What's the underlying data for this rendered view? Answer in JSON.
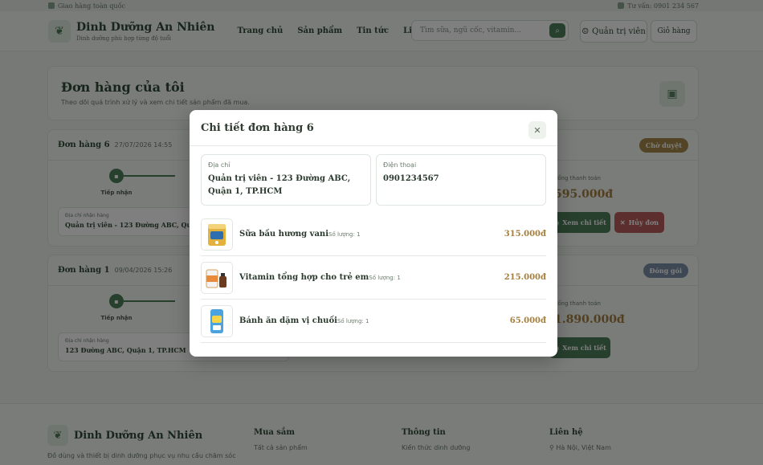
{
  "topbar": {
    "shipping": "Giao hàng toàn quốc",
    "hotline": "Tư vấn: 0901 234 567"
  },
  "header": {
    "brand": "Dinh Dưỡng An Nhiên",
    "tagline": "Dinh dưỡng phù hợp từng độ tuổi",
    "nav": [
      "Trang chủ",
      "Sản phẩm",
      "Tin tức",
      "Liên hệ"
    ],
    "search_placeholder": "Tìm sữa, ngũ cốc, vitamin...",
    "account": "Quản trị viên",
    "cart": "Giỏ hàng"
  },
  "page": {
    "title": "Đơn hàng của tôi",
    "subtitle": "Theo dõi quá trình xử lý và xem chi tiết sản phẩm đã mua."
  },
  "orders": [
    {
      "id": "Đơn hàng 6",
      "date": "27/07/2026 14:55",
      "status": "Chờ duyệt",
      "step": "Tiếp nhận",
      "addr_label": "Địa chỉ nhận hàng",
      "addr": "Quản trị viên - 123 Đường ABC, Quận 1, TP.HCM",
      "pay_label": "Tổng thanh toán",
      "total": "595.000đ",
      "detail_btn": "Xem chi tiết",
      "cancel_btn": "Hủy đơn"
    },
    {
      "id": "Đơn hàng 1",
      "date": "09/04/2026 15:26",
      "status": "Đóng gói",
      "step": "Tiếp nhận",
      "addr_label": "Địa chỉ nhận hàng",
      "addr": "123 Đường ABC, Quận 1, TP.HCM",
      "pay_label": "Tổng thanh toán",
      "total": "1.890.000đ",
      "detail_btn": "Xem chi tiết"
    }
  ],
  "footer": {
    "brand": "Dinh Dưỡng An Nhiên",
    "desc": "Đồ dùng và thiết bị dinh dưỡng phục vụ nhu cầu chăm sóc",
    "col1": {
      "title": "Mua sắm",
      "link": "Tất cả sản phẩm"
    },
    "col2": {
      "title": "Thông tin",
      "link": "Kiến thức dinh dưỡng"
    },
    "col3": {
      "title": "Liên hệ",
      "link": "Hà Nội, Việt Nam"
    }
  },
  "modal": {
    "title": "Chi tiết đơn hàng 6",
    "address_label": "Địa chỉ",
    "address": "Quản trị viên - 123 Đường ABC, Quận 1, TP.HCM",
    "phone_label": "Điện thoại",
    "phone": "0901234567",
    "items": [
      {
        "name": "Sữa bầu hương vani",
        "qty": "Số lượng: 1",
        "price": "315.000đ"
      },
      {
        "name": "Vitamin tổng hợp cho trẻ em",
        "qty": "Số lượng: 1",
        "price": "215.000đ"
      },
      {
        "name": "Bánh ăn dặm vị chuối",
        "qty": "Số lượng: 1",
        "price": "65.000đ"
      }
    ]
  }
}
